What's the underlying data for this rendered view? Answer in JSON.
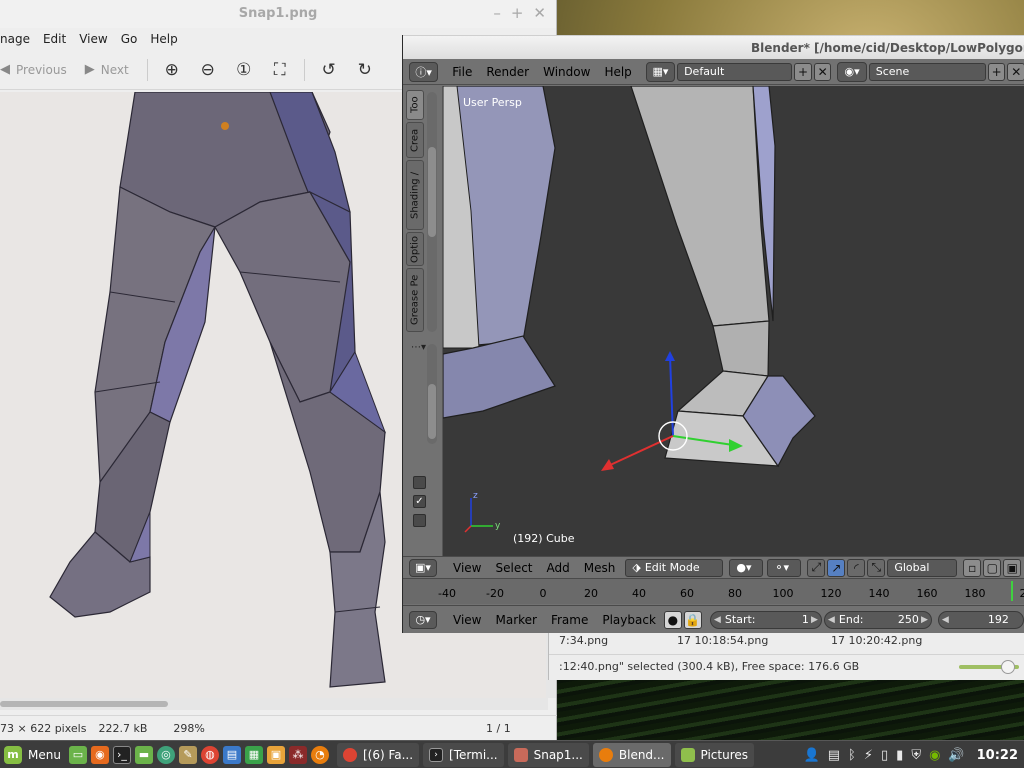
{
  "viewer": {
    "title": "Snap1.png",
    "menu": [
      "nage",
      "Edit",
      "View",
      "Go",
      "Help"
    ],
    "previous_label": "Previous",
    "next_label": "Next",
    "status_dimensions": "73 × 622 pixels",
    "status_filesize": "222.7 kB",
    "status_zoom": "298%",
    "status_page": "1 / 1"
  },
  "files": {
    "row": {
      "name": "7:34.png",
      "mod1": "17 10:18:54.png",
      "mod2": "17 10:20:42.png"
    },
    "status": ":12:40.png\" selected (300.4 kB), Free space: 176.6 GB"
  },
  "blender": {
    "title": "Blender* [/home/cid/Desktop/LowPolygonMa",
    "menu": [
      "File",
      "Render",
      "Window",
      "Help"
    ],
    "layout": "Default",
    "scene": "Scene",
    "tabs": [
      "Too",
      "Crea",
      "Shading /",
      "Optio",
      "Grease Pe"
    ],
    "view_label": "User Persp",
    "object_label": "(192) Cube",
    "header3d": {
      "view": "View",
      "select": "Select",
      "add": "Add",
      "mesh": "Mesh",
      "mode": "Edit Mode",
      "orientation": "Global"
    },
    "timeline_ticks": [
      "-40",
      "-20",
      "0",
      "20",
      "40",
      "60",
      "80",
      "100",
      "120",
      "140",
      "160",
      "180",
      "2"
    ],
    "timeline_header": {
      "view": "View",
      "marker": "Marker",
      "frame": "Frame",
      "playback": "Playback",
      "start_label": "Start:",
      "start_value": "1",
      "end_label": "End:",
      "end_value": "250",
      "current_frame": "192"
    },
    "colors": {
      "axis_x": "#e03030",
      "axis_y": "#30d030",
      "axis_z": "#2040e0"
    }
  },
  "taskbar": {
    "menu_label": "Menu",
    "tasks": [
      {
        "label": "[(6) Fa...",
        "icon": "chrome-icon"
      },
      {
        "label": "[Termi...",
        "icon": "terminal-icon"
      },
      {
        "label": "Snap1...",
        "icon": "image-viewer-icon"
      },
      {
        "label": "Blend...",
        "icon": "blender-icon"
      },
      {
        "label": "Pictures",
        "icon": "folder-icon"
      }
    ],
    "clock": "10:22"
  }
}
